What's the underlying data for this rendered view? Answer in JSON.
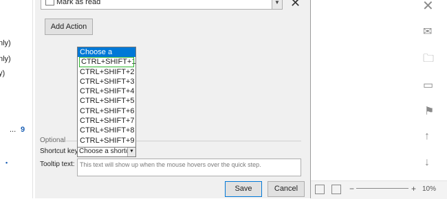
{
  "left_panel": {
    "lines": [
      "nly)",
      "nly)",
      "y)"
    ],
    "count": "9",
    "ellipsis": "..."
  },
  "dialog": {
    "action_combo": {
      "value": "Mark as read"
    },
    "close_glyph": "✕",
    "add_action_label": "Add Action",
    "shortcut_dropdown": {
      "header": "Choose a shortcut",
      "options": [
        "CTRL+SHIFT+1",
        "CTRL+SHIFT+2",
        "CTRL+SHIFT+3",
        "CTRL+SHIFT+4",
        "CTRL+SHIFT+5",
        "CTRL+SHIFT+6",
        "CTRL+SHIFT+7",
        "CTRL+SHIFT+8",
        "CTRL+SHIFT+9"
      ]
    },
    "optional_label": "Optional",
    "shortcut_key_label": "Shortcut key:",
    "shortcut_key_value": "Choose a shortcut",
    "tooltip_label": "Tooltip text:",
    "tooltip_placeholder": "This text will show up when the mouse hovers over the quick step.",
    "save_label": "Save",
    "cancel_label": "Cancel"
  },
  "right_panel": {
    "zoom": "10%",
    "zoom_minus": "−",
    "zoom_plus": "+",
    "icons": [
      "close-icon",
      "reply-icon",
      "move-icon",
      "mark-icon",
      "flag-icon",
      "up-arrow-icon",
      "down-arrow-icon"
    ]
  }
}
